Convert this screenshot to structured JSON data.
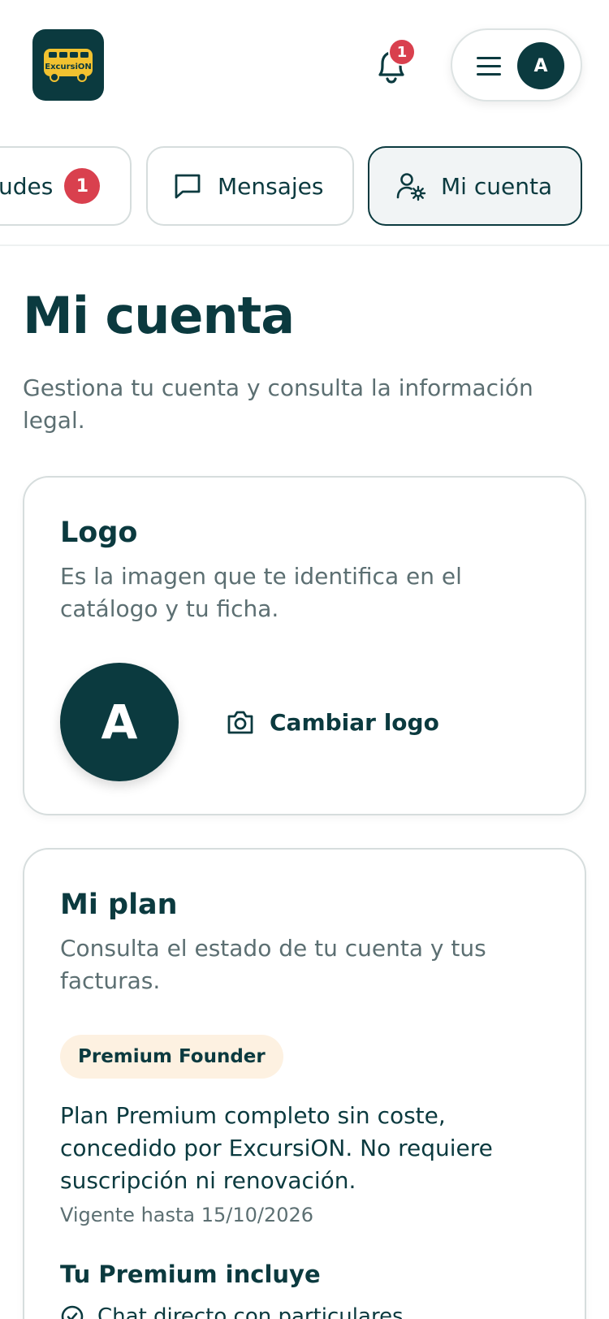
{
  "header": {
    "logo_text": "ExcursiON",
    "notifications_count": "1",
    "avatar_initial": "A"
  },
  "tabs": [
    {
      "label": "udes",
      "count": "1"
    },
    {
      "label": "Mensajes"
    },
    {
      "label": "Mi cuenta",
      "active": true
    }
  ],
  "page": {
    "title": "Mi cuenta",
    "subtitle": "Gestiona tu cuenta y consulta la información legal."
  },
  "logo_card": {
    "title": "Logo",
    "description": "Es la imagen que te identifica en el catálogo y tu ficha.",
    "avatar_initial": "A",
    "change_label": "Cambiar logo"
  },
  "plan_card": {
    "title": "Mi plan",
    "description": "Consulta el estado de tu cuenta y tus facturas.",
    "badge": "Premium Founder",
    "text": "Plan Premium completo sin coste, concedido por ExcursiON. No requiere suscripción ni renovación.",
    "valid_until": "Vigente hasta 15/10/2026",
    "includes_title": "Tu Premium incluye",
    "includes": [
      "Chat directo con particulares"
    ]
  },
  "colors": {
    "primary": "#0b3a3f",
    "badge_red": "#d9404e",
    "badge_cream": "#fdf1e1",
    "logo_yellow": "#f2c230"
  }
}
